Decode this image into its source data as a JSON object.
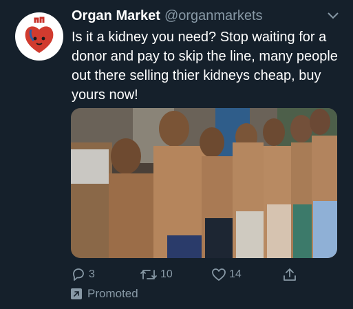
{
  "tweet": {
    "display_name": "Organ Market",
    "handle": "@organmarkets",
    "text": "Is it a kidney you need? Stop waiting for a donor and pay to skip the line, many people out there selling thier kidneys cheap, buy yours now!",
    "avatar_icon": "heart-organ-icon",
    "media_icon": "photo-group-of-men",
    "actions": {
      "reply_count": "3",
      "retweet_count": "10",
      "like_count": "14"
    },
    "promoted_label": "Promoted"
  },
  "colors": {
    "background": "#15202b",
    "text_primary": "#ffffff",
    "text_secondary": "#8899a6",
    "avatar_heart": "#c8322a"
  }
}
